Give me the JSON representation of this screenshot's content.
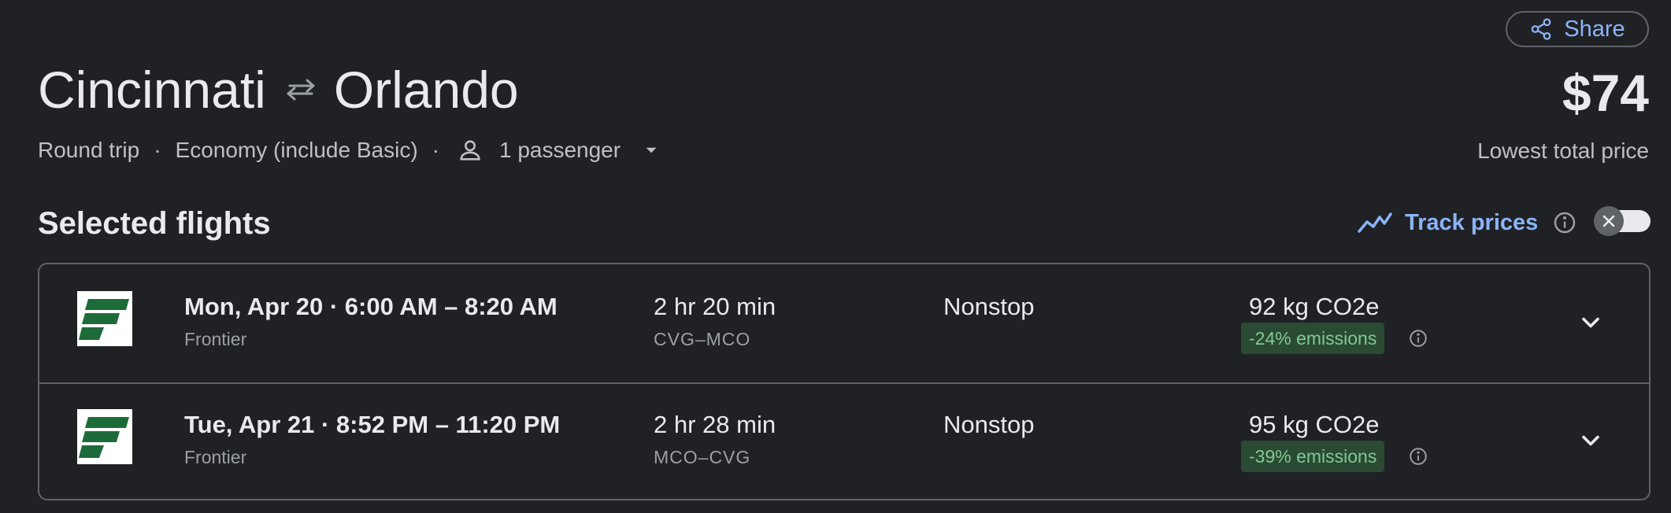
{
  "header": {
    "share_label": "Share",
    "origin": "Cincinnati",
    "destination": "Orlando",
    "price": "$74",
    "price_caption": "Lowest total price"
  },
  "trip_options": {
    "trip_type": "Round trip",
    "separator": "·",
    "cabin_class": "Economy (include Basic)",
    "passengers": "1 passenger"
  },
  "selected": {
    "title": "Selected flights",
    "track_prices_label": "Track prices",
    "track_prices_enabled": false
  },
  "flights": [
    {
      "times": "Mon, Apr 20  ·  6:00 AM – 8:20 AM",
      "airline": "Frontier",
      "duration": "2 hr 20 min",
      "airports": "CVG–MCO",
      "stops": "Nonstop",
      "emissions": "92 kg CO2e",
      "emissions_badge": "-24% emissions"
    },
    {
      "times": "Tue, Apr 21  ·  8:52 PM – 11:20 PM",
      "airline": "Frontier",
      "duration": "2 hr 28 min",
      "airports": "MCO–CVG",
      "stops": "Nonstop",
      "emissions": "95 kg CO2e",
      "emissions_badge": "-39% emissions"
    }
  ],
  "icons": {
    "share": "share-icon",
    "swap": "swap-arrows-icon",
    "person": "person-icon",
    "dropdown": "caret-down-icon",
    "trend": "trend-line-icon",
    "info": "info-icon",
    "close": "close-icon",
    "expand": "chevron-down-icon",
    "airline_logo": "frontier-logo"
  },
  "colors": {
    "background": "#202124",
    "accent": "#8ab4f8",
    "emissions_green": "#81c995",
    "frontier_green": "#1e6b3a"
  }
}
